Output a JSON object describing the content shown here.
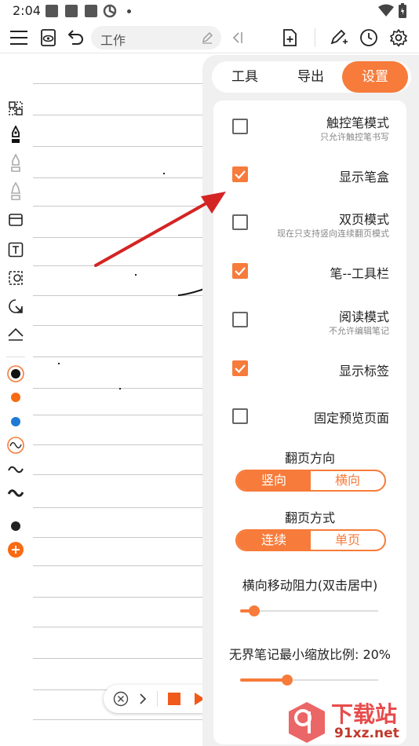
{
  "status_bar": {
    "time": "2:04"
  },
  "toolbar": {
    "title_value": "工作"
  },
  "tabs": [
    {
      "label": "工具",
      "active": false
    },
    {
      "label": "导出",
      "active": false
    },
    {
      "label": "设置",
      "active": true
    }
  ],
  "settings": {
    "options": [
      {
        "label": "触控笔模式",
        "sub": "只允许触控笔书写",
        "checked": false
      },
      {
        "label": "显示笔盒",
        "sub": "",
        "checked": true
      },
      {
        "label": "双页模式",
        "sub": "现在只支持竖向连续翻页模式",
        "checked": false
      },
      {
        "label": "笔--工具栏",
        "sub": "",
        "checked": true
      },
      {
        "label": "阅读模式",
        "sub": "不允许编辑笔记",
        "checked": false
      },
      {
        "label": "显示标签",
        "sub": "",
        "checked": true
      },
      {
        "label": "固定预览页面",
        "sub": "",
        "checked": false
      }
    ],
    "page_direction": {
      "title": "翻页方向",
      "options": [
        "竖向",
        "横向"
      ],
      "selected": 0
    },
    "page_mode": {
      "title": "翻页方式",
      "options": [
        "连续",
        "单页"
      ],
      "selected": 0
    },
    "horizontal_drag": {
      "title": "横向移动阻力(双击居中)",
      "value": 0.1
    },
    "min_zoom": {
      "title": "无界笔记最小缩放比例: 20%",
      "value": 0.34
    }
  },
  "palette": {
    "colors": [
      "#111111",
      "#f96a14",
      "#1f7ad6",
      "#222222"
    ]
  },
  "watermark": {
    "text_cn": "下载站",
    "text_url": "91xz.net"
  },
  "colors": {
    "accent": "#f77b3a",
    "arrow": "#d42424"
  },
  "icons": {
    "toolbar": [
      "menu-icon",
      "preview-eye-icon",
      "undo-icon",
      "edit-pencil-icon",
      "collapse-left-icon",
      "add-page-icon",
      "pen-plus-icon",
      "clock-icon",
      "gear-icon"
    ],
    "left": [
      "select-icon",
      "fountain-pen-icon",
      "pencil-icon",
      "marker-icon",
      "eraser-icon",
      "text-box-icon",
      "lasso-icon",
      "shape-icon",
      "ruler-icon"
    ]
  }
}
